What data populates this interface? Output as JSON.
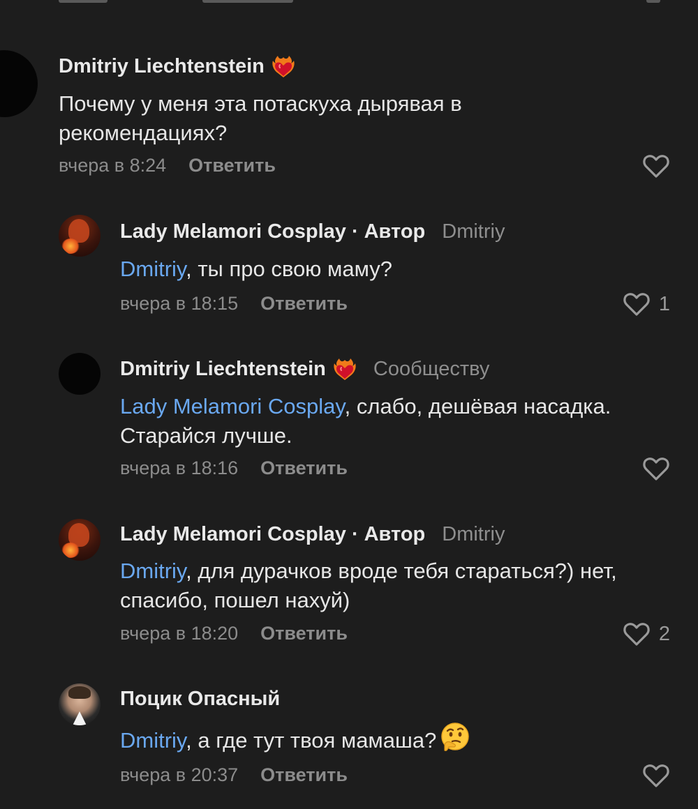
{
  "comments": [
    {
      "author": "Dmitriy Liechtenstein",
      "badge": "heart-fire-icon",
      "text_parts": [
        "",
        "Почему у меня эта потаскуха дырявая в рекомендациях?"
      ],
      "time": "вчера в 8:24",
      "reply_label": "Ответить",
      "likes": ""
    },
    {
      "author": "Lady Melamori Cosplay",
      "role": "Автор",
      "separator": "·",
      "reply_to": "Dmitriy",
      "mention": "Dmitriy",
      "text": ", ты про свою маму?",
      "time": "вчера в 18:15",
      "reply_label": "Ответить",
      "likes": "1"
    },
    {
      "author": "Dmitriy Liechtenstein",
      "badge": "heart-fire-icon",
      "reply_to": "Сообществу",
      "mention": "Lady Melamori Cosplay",
      "text_line1": ", слабо, дешёвая насадка.",
      "text_line2": "Старайся лучше.",
      "time": "вчера в 18:16",
      "reply_label": "Ответить",
      "likes": ""
    },
    {
      "author": "Lady Melamori Cosplay",
      "role": "Автор",
      "separator": "·",
      "reply_to": "Dmitriy",
      "mention": "Dmitriy",
      "text_line1": ", для дурачков вроде тебя стараться?) нет,",
      "text_line2": "спасибо, пошел нахуй)",
      "time": "вчера в 18:20",
      "reply_label": "Ответить",
      "likes": "2"
    },
    {
      "author": "Поцик Опасный",
      "mention": "Dmitriy",
      "text": ", а где тут твоя мамаша?",
      "emoji": "thinking-face-icon",
      "time": "вчера в 20:37",
      "reply_label": "Ответить",
      "likes": ""
    }
  ],
  "colors": {
    "background": "#1d1d1d",
    "mention": "#6aa8f0",
    "secondary_text": "#8c8c8c"
  }
}
